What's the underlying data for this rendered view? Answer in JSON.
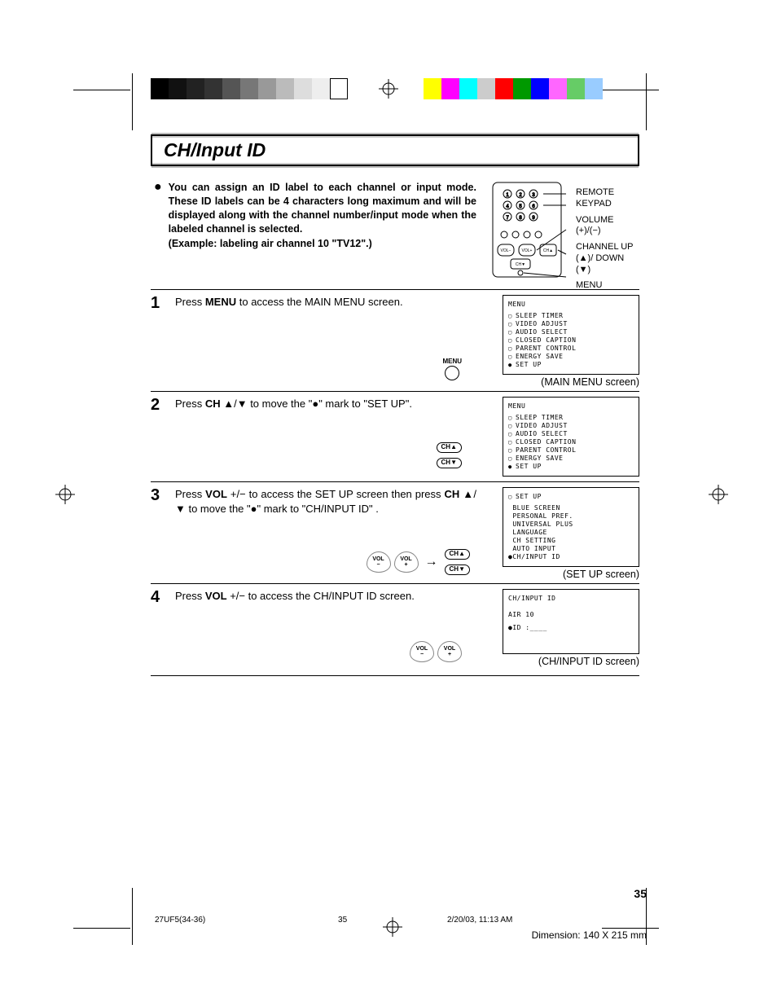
{
  "title": "CH/Input ID",
  "intro": {
    "text": "You can assign an ID label to each channel or input mode. These ID labels can be 4 characters long maximum and will be displayed along with the channel number/input mode when the labeled channel is selected.",
    "example": "(Example: labeling air channel 10 \"TV12\".)"
  },
  "remote_labels": {
    "keypad": "REMOTE KEYPAD",
    "volume": "VOLUME (+)/(−)",
    "channel": "CHANNEL UP (▲)/ DOWN (▼)",
    "menu": "MENU"
  },
  "steps": {
    "s1": {
      "num": "1",
      "text_a": "Press ",
      "text_b": "MENU",
      "text_c": " to access the MAIN MENU screen.",
      "caption": "(MAIN MENU screen)",
      "menu_btn": "MENU"
    },
    "s2": {
      "num": "2",
      "text_a": "Press ",
      "text_b": "CH",
      "text_c": " ▲/▼ to move the \"●\" mark to \"SET UP\".",
      "caption": "",
      "ch_up": "CH▲",
      "ch_dn": "CH▼"
    },
    "s3": {
      "num": "3",
      "text_a": "Press ",
      "text_b": "VOL",
      "text_c": " +/− to access the SET UP screen then press ",
      "text_d": "CH",
      "text_e": " ▲/▼ to move the \"●\" mark to \"CH/INPUT ID\" .",
      "caption": "(SET UP screen)",
      "vol_minus": "VOL −",
      "vol_plus": "VOL +",
      "ch_up": "CH▲",
      "ch_dn": "CH▼"
    },
    "s4": {
      "num": "4",
      "text_a": "Press ",
      "text_b": "VOL",
      "text_c": " +/− to access the CH/INPUT ID screen.",
      "caption": "(CH/INPUT ID screen)",
      "vol_minus": "VOL −",
      "vol_plus": "VOL +"
    }
  },
  "screens": {
    "main_menu": {
      "header": "MENU",
      "items": [
        "SLEEP TIMER",
        "VIDEO ADJUST",
        "AUDIO SELECT",
        "CLOSED CAPTION",
        "PARENT CONTROL",
        "ENERGY SAVE",
        "SET UP"
      ],
      "selected_index": 6
    },
    "main_menu_2": {
      "header": "MENU",
      "items": [
        "SLEEP TIMER",
        "VIDEO ADJUST",
        "AUDIO SELECT",
        "CLOSED CAPTION",
        "PARENT CONTROL",
        "ENERGY SAVE",
        "SET UP"
      ],
      "selected_index": 6
    },
    "setup": {
      "header": "SET UP",
      "items": [
        "BLUE SCREEN",
        "PERSONAL PREF.",
        "UNIVERSAL PLUS",
        "LANGUAGE",
        "CH SETTING",
        "AUTO INPUT",
        "CH/INPUT ID"
      ],
      "selected_index": 6
    },
    "chinput": {
      "header": "CH/INPUT ID",
      "line1": "AIR 10",
      "line2": "●ID :____"
    }
  },
  "footer": {
    "file": "27UF5(34-36)",
    "pagenum_inner": "35",
    "timestamp": "2/20/03, 11:13 AM",
    "page_number": "35",
    "dimension": "Dimension: 140  X 215 mm"
  }
}
